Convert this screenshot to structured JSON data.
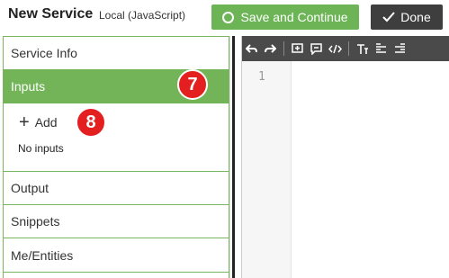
{
  "header": {
    "title": "New Service",
    "subtitle": "Local (JavaScript)",
    "save_label": "Save and Continue",
    "done_label": "Done"
  },
  "sidebar": {
    "items": [
      {
        "label": "Service Info"
      },
      {
        "label": "Inputs",
        "active": true
      },
      {
        "label": "Output"
      },
      {
        "label": "Snippets"
      },
      {
        "label": "Me/Entities"
      }
    ],
    "add_label": "Add",
    "empty_text": "No inputs"
  },
  "annotations": {
    "badge_7": "7",
    "badge_8": "8"
  },
  "editor": {
    "line_numbers": [
      "1"
    ],
    "toolbar_icons": [
      "undo-icon",
      "redo-icon",
      "add-comment-icon",
      "comment-icon",
      "code-icon",
      "text-size-icon",
      "align-left-icon",
      "align-right-icon"
    ]
  },
  "colors": {
    "accent_green": "#6cb455",
    "dark_button": "#3e3e3e",
    "badge_red": "#e41f1f",
    "toolbar_bg": "#4a4a4a"
  }
}
